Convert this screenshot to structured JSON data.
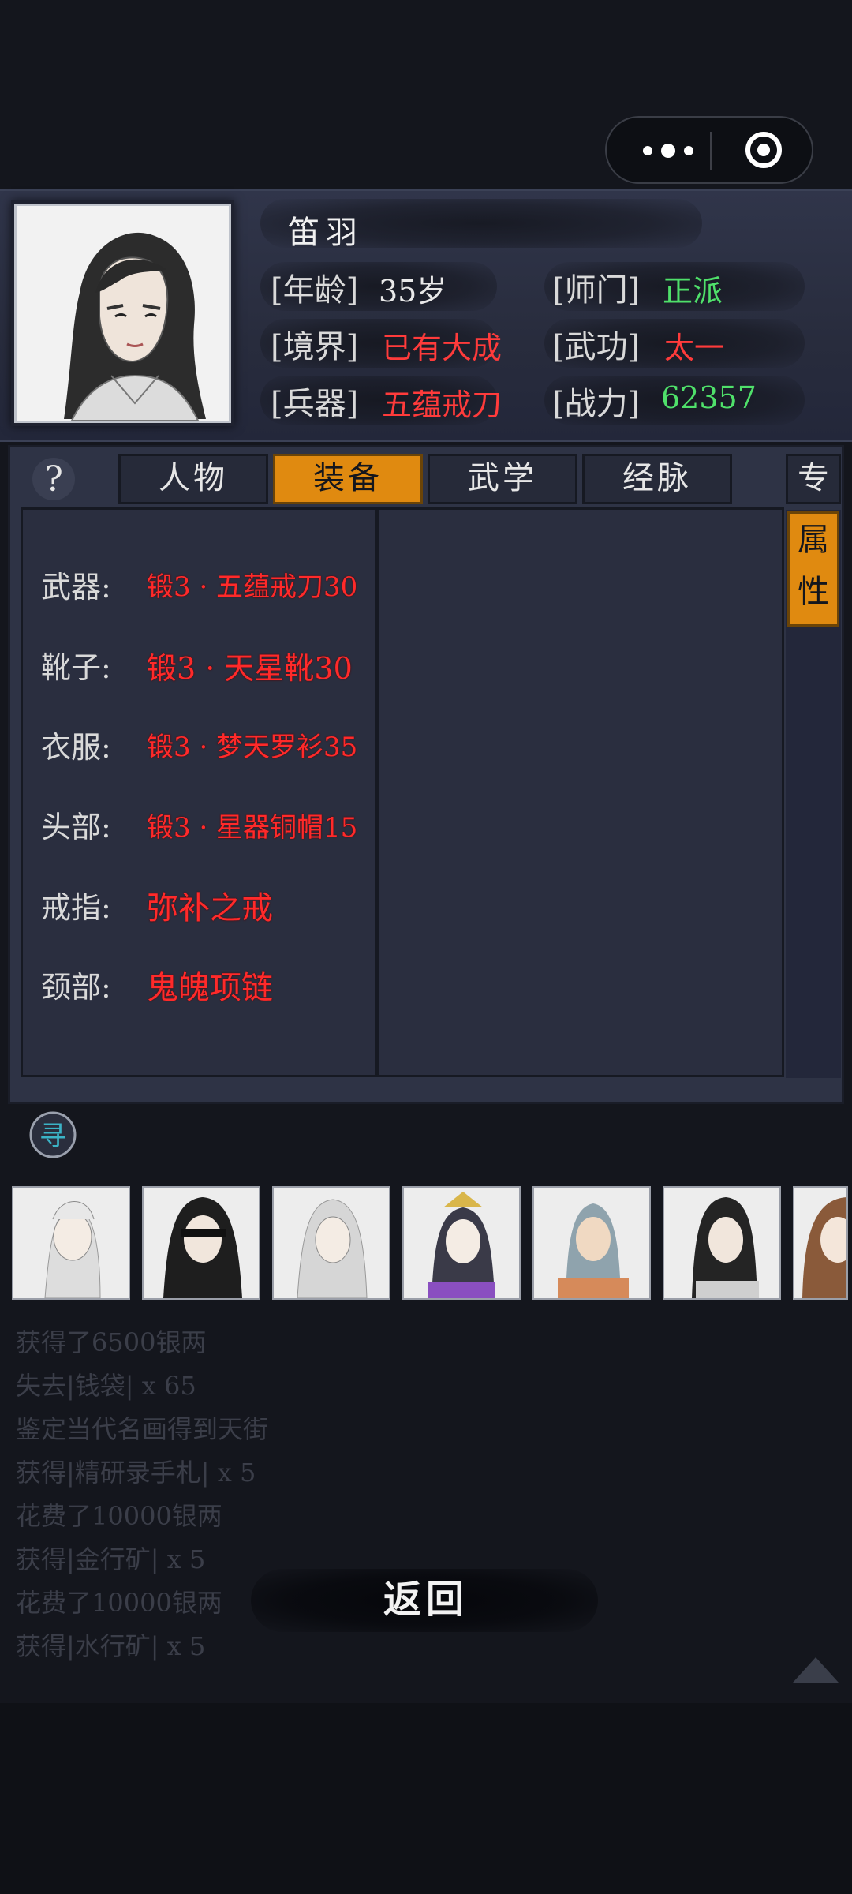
{
  "profile": {
    "name": "笛羽",
    "age_label": "[年龄]",
    "age": "35岁",
    "sect_label": "[师门]",
    "sect": "正派",
    "realm_label": "[境界]",
    "realm": "已有大成",
    "martial_label": "[武功]",
    "martial": "太一",
    "weapon_label": "[兵器]",
    "weapon": "五蕴戒刀",
    "power_label": "[战力]",
    "power": "62357"
  },
  "tabs": [
    {
      "label": "人物",
      "active": false
    },
    {
      "label": "装备",
      "active": true
    },
    {
      "label": "武学",
      "active": false
    },
    {
      "label": "经脉",
      "active": false
    }
  ],
  "side_tabs": {
    "special": "专",
    "attr_1": "属",
    "attr_2": "性"
  },
  "equipment": [
    {
      "slot": "武器:",
      "item": "锻3 · 五蕴戒刀30"
    },
    {
      "slot": "靴子:",
      "item": "锻3 · 天星靴30"
    },
    {
      "slot": "衣服:",
      "item": "锻3 · 梦天罗衫35"
    },
    {
      "slot": "头部:",
      "item": "锻3 · 星器铜帽15"
    },
    {
      "slot": "戒指:",
      "item": "弥补之戒"
    },
    {
      "slot": "颈部:",
      "item": "鬼魄项链"
    }
  ],
  "search_icon_glyph": "寻",
  "log": [
    "获得了6500银两",
    "失去|钱袋| x 65",
    "鉴定当代名画得到天街",
    "获得|精研录手札| x 5",
    "花费了10000银两",
    "获得|金行矿| x 5",
    "花费了10000银两",
    "获得|水行矿| x 5"
  ],
  "back_label": "返回",
  "colors": {
    "accent": "#e08a10",
    "green": "#4fe06a",
    "red": "#ff3b3b",
    "panel": "#2e3345"
  }
}
